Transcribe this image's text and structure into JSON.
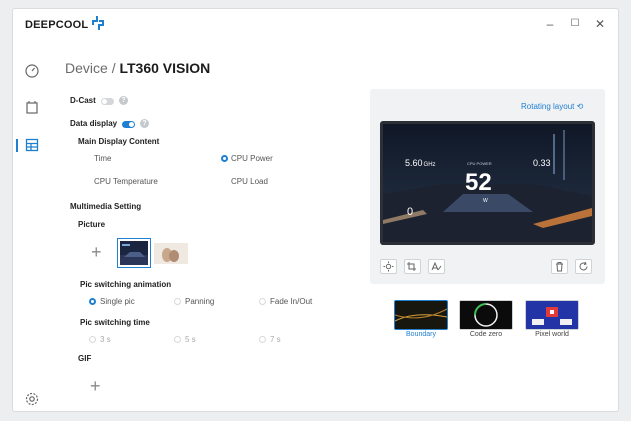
{
  "app": {
    "brand": "DEEPCOOL",
    "window_controls": {
      "minimize": "–",
      "maximize": "☐",
      "close": "✕"
    }
  },
  "breadcrumb": {
    "section": "Device",
    "separator": "/",
    "device": "LT360 VISION"
  },
  "settings": {
    "dcast_label": "D-Cast",
    "data_display_label": "Data display",
    "main_content_label": "Main Display Content",
    "main_options": {
      "time": "Time",
      "cpu_power": "CPU Power",
      "cpu_temperature": "CPU Temperature",
      "cpu_load": "CPU Load"
    },
    "multimedia_label": "Multimedia Setting",
    "picture_label": "Picture",
    "animation_label": "Pic switching animation",
    "animation_options": {
      "single": "Single pic",
      "panning": "Panning",
      "fade": "Fade In/Out"
    },
    "time_label": "Pic switching time",
    "time_options": {
      "t3": "3 s",
      "t5": "5 s",
      "t7": "7 s"
    },
    "gif_label": "GIF"
  },
  "preview": {
    "rotate_label": "Rotating layout",
    "screen": {
      "left_value": "5.60",
      "left_unit": "GHz",
      "center_label": "CPU POWER",
      "center_value": "52",
      "center_unit": "W",
      "right_value": "0.33",
      "bottom_left": "0"
    }
  },
  "themes": [
    {
      "label": "Boundary"
    },
    {
      "label": "Code zero"
    },
    {
      "label": "Pixel world"
    }
  ],
  "colors": {
    "accent": "#1f7fd0"
  }
}
